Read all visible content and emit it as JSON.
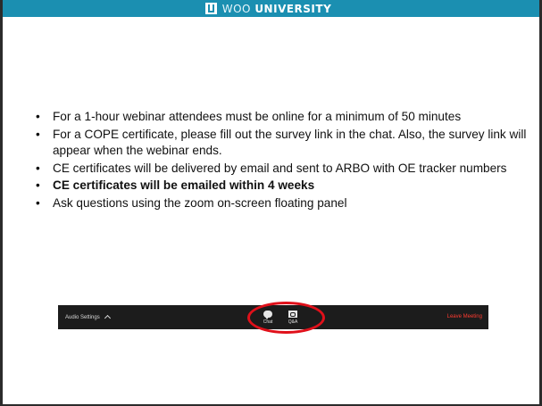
{
  "header": {
    "logo_word1": "WOO",
    "logo_word2": "UNIVERSITY",
    "accent_color": "#1b8fb1"
  },
  "slide": {
    "bullets": [
      {
        "text": "For a 1-hour webinar attendees must be online for a minimum of 50 minutes",
        "bold": false
      },
      {
        "text": "For a COPE certificate, please fill out the survey link in the chat. Also, the survey link will appear when the webinar ends.",
        "bold": false
      },
      {
        "text": "CE certificates will be delivered by email and sent to ARBO with OE tracker numbers",
        "bold": false
      },
      {
        "text": "CE certificates will be emailed within 4 weeks",
        "bold": true
      },
      {
        "text": "Ask questions using the zoom on-screen floating panel",
        "bold": false
      }
    ],
    "bullet_glyph": "•"
  },
  "zoom_toolbar": {
    "audio_settings_label": "Audio Settings",
    "chat_label": "Chat",
    "qa_label": "Q&A",
    "leave_label": "Leave Meeting",
    "leave_color": "#ff3b30",
    "highlight_color": "#e0101a"
  }
}
